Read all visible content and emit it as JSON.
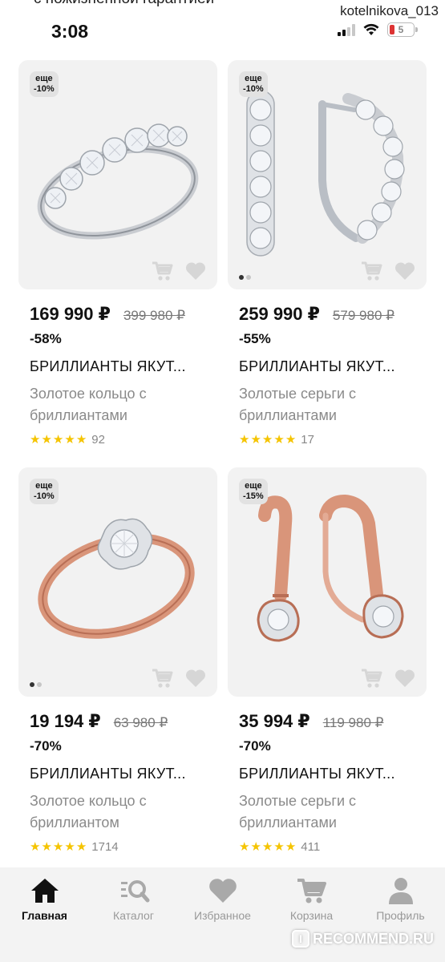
{
  "status_bar": {
    "top_cut_text": "с пожизненной гарантией",
    "username": "kotelnikova_013",
    "time": "3:08",
    "battery": "5"
  },
  "products": [
    {
      "badge_line1": "еще",
      "badge_line2": "-10%",
      "price": "169 990 ₽",
      "old_price": "399 980 ₽",
      "discount": "-58%",
      "brand": "БРИЛЛИАНТЫ ЯКУТ...",
      "description": "Золотое кольцо с бриллиантами",
      "reviews": "92",
      "stars": 5
    },
    {
      "badge_line1": "еще",
      "badge_line2": "-10%",
      "price": "259 990 ₽",
      "old_price": "579 980 ₽",
      "discount": "-55%",
      "brand": "БРИЛЛИАНТЫ ЯКУТ...",
      "description": "Золотые серьги с бриллиантами",
      "reviews": "17",
      "stars": 5
    },
    {
      "badge_line1": "еще",
      "badge_line2": "-10%",
      "price": "19 194 ₽",
      "old_price": "63 980 ₽",
      "discount": "-70%",
      "brand": "БРИЛЛИАНТЫ ЯКУТ...",
      "description": "Золотое кольцо с бриллиантом",
      "reviews": "1714",
      "stars": 5
    },
    {
      "badge_line1": "еще",
      "badge_line2": "-15%",
      "price": "35 994 ₽",
      "old_price": "119 980 ₽",
      "discount": "-70%",
      "brand": "БРИЛЛИАНТЫ ЯКУТ...",
      "description": "Золотые серьги с бриллиантами",
      "reviews": "411",
      "stars": 5
    }
  ],
  "bottom_nav": [
    {
      "label": "Главная",
      "icon": "home-icon",
      "active": true
    },
    {
      "label": "Каталог",
      "icon": "catalog-search-icon",
      "active": false
    },
    {
      "label": "Избранное",
      "icon": "heart-icon",
      "active": false
    },
    {
      "label": "Корзина",
      "icon": "cart-icon",
      "active": false
    },
    {
      "label": "Профиль",
      "icon": "profile-icon",
      "active": false
    }
  ],
  "watermark": {
    "letter": "I",
    "text": "RECOMMEND.RU"
  },
  "colors": {
    "star": "#f5c400",
    "card_bg": "#f2f2f2",
    "nav_bg": "#f3f3f3",
    "rose_gold": "#d9957a",
    "silver": "#c9ccd1"
  }
}
